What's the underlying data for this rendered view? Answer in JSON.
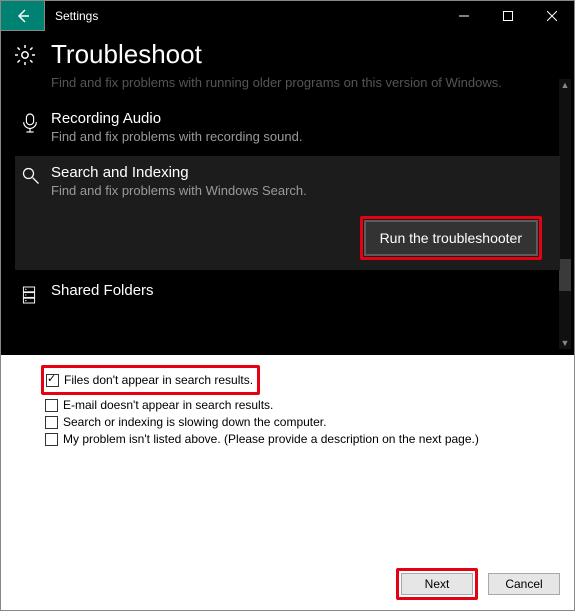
{
  "titlebar": {
    "label": "Settings"
  },
  "page": {
    "title": "Troubleshoot"
  },
  "items": {
    "compat": {
      "desc": "Find and fix problems with running older programs on this version of Windows."
    },
    "recording": {
      "title": "Recording Audio",
      "desc": "Find and fix problems with recording sound."
    },
    "search": {
      "title": "Search and Indexing",
      "desc": "Find and fix problems with Windows Search.",
      "run": "Run the troubleshooter"
    },
    "shared": {
      "title": "Shared Folders"
    }
  },
  "dialog": {
    "opt1": "Files don't appear in search results.",
    "opt2": "E-mail doesn't appear in search results.",
    "opt3": "Search or indexing is slowing down the computer.",
    "opt4": "My problem isn't listed above. (Please provide a description on the next page.)",
    "next": "Next",
    "cancel": "Cancel"
  }
}
